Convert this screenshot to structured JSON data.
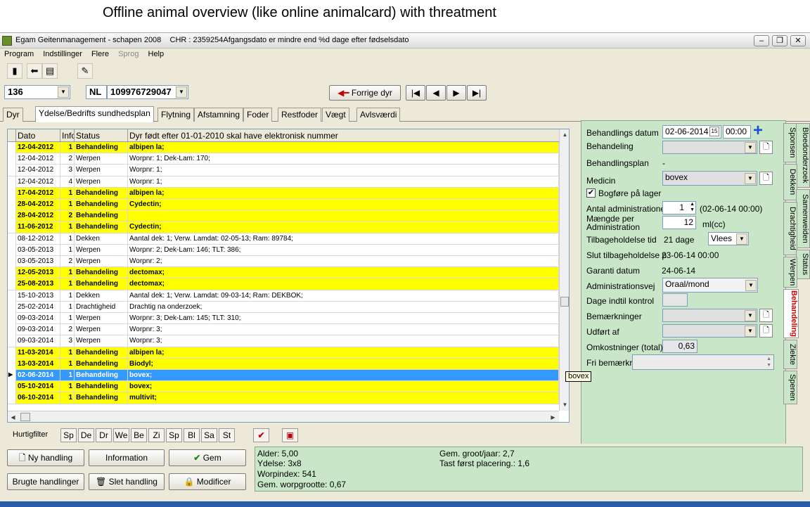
{
  "caption": "Offline animal overview (like online animalcard) with threatment",
  "window": {
    "title": "Egam Geitenmanagement - schapen 2008",
    "title_info": "CHR : 2359254Afgangsdato er mindre end %d dage efter fødselsdato"
  },
  "menu": [
    {
      "label": "Program"
    },
    {
      "label": "Indstillinger"
    },
    {
      "label": "Flere"
    },
    {
      "label": "Sprog"
    },
    {
      "label": "Help"
    }
  ],
  "selector": {
    "animal_no": "136",
    "country": "NL",
    "ear_no": "109976729047"
  },
  "nav": {
    "prev": "Forrige dyr"
  },
  "tabs": [
    "Dyr",
    "Ydelse/Bedrifts sundhedsplan",
    "Flytning",
    "Afstamning",
    "Foder",
    "Restfoder",
    "Vægt",
    "Avlsværdi"
  ],
  "grid": {
    "headers": [
      "Dato",
      "Info",
      "Status",
      "Dyr født efter 01-01-2010 skal have elektronisk nummer"
    ],
    "rows": [
      {
        "date": "12-04-2012",
        "info": "1",
        "status": "Behandeling",
        "text": "albipen la;",
        "type": "beh"
      },
      {
        "date": "12-04-2012",
        "info": "2",
        "status": "Werpen",
        "text": "Worpnr: 1; Dek-Lam: 170;",
        "type": ""
      },
      {
        "date": "12-04-2012",
        "info": "3",
        "status": "Werpen",
        "text": "Worpnr: 1;",
        "type": ""
      },
      {
        "date": "12-04-2012",
        "info": "4",
        "status": "Werpen",
        "text": "Worpnr: 1;",
        "type": ""
      },
      {
        "date": "17-04-2012",
        "info": "1",
        "status": "Behandeling",
        "text": "albipen la;",
        "type": "beh"
      },
      {
        "date": "28-04-2012",
        "info": "1",
        "status": "Behandeling",
        "text": "Cydectin;",
        "type": "beh"
      },
      {
        "date": "28-04-2012",
        "info": "2",
        "status": "Behandeling",
        "text": "",
        "type": "beh"
      },
      {
        "date": "11-06-2012",
        "info": "1",
        "status": "Behandeling",
        "text": "Cydectin;",
        "type": "beh"
      },
      {
        "date": "08-12-2012",
        "info": "1",
        "status": "Dekken",
        "text": "Aantal dek: 1; Verw. Lamdat: 02-05-13; Ram: 89784;",
        "type": ""
      },
      {
        "date": "03-05-2013",
        "info": "1",
        "status": "Werpen",
        "text": "Worpnr: 2; Dek-Lam: 146; TLT: 386;",
        "type": ""
      },
      {
        "date": "03-05-2013",
        "info": "2",
        "status": "Werpen",
        "text": "Worpnr: 2;",
        "type": ""
      },
      {
        "date": "12-05-2013",
        "info": "1",
        "status": "Behandeling",
        "text": "dectomax;",
        "type": "beh"
      },
      {
        "date": "25-08-2013",
        "info": "1",
        "status": "Behandeling",
        "text": "dectomax;",
        "type": "beh"
      },
      {
        "date": "15-10-2013",
        "info": "1",
        "status": "Dekken",
        "text": "Aantal dek: 1; Verw. Lamdat: 09-03-14; Ram: DEKBOK;",
        "type": ""
      },
      {
        "date": "25-02-2014",
        "info": "1",
        "status": "Drachtigheid",
        "text": "Drachtig na onderzoek;",
        "type": ""
      },
      {
        "date": "09-03-2014",
        "info": "1",
        "status": "Werpen",
        "text": "Worpnr: 3; Dek-Lam: 145; TLT: 310;",
        "type": ""
      },
      {
        "date": "09-03-2014",
        "info": "2",
        "status": "Werpen",
        "text": "Worpnr: 3;",
        "type": ""
      },
      {
        "date": "09-03-2014",
        "info": "3",
        "status": "Werpen",
        "text": "Worpnr: 3;",
        "type": ""
      },
      {
        "date": "11-03-2014",
        "info": "1",
        "status": "Behandeling",
        "text": "albipen la;",
        "type": "beh"
      },
      {
        "date": "13-03-2014",
        "info": "1",
        "status": "Behandeling",
        "text": "Biodyl;",
        "type": "beh"
      },
      {
        "date": "02-06-2014",
        "info": "1",
        "status": "Behandeling",
        "text": "bovex;",
        "type": "sel"
      },
      {
        "date": "05-10-2014",
        "info": "1",
        "status": "Behandeling",
        "text": "bovex;",
        "type": "beh"
      },
      {
        "date": "06-10-2014",
        "info": "1",
        "status": "Behandeling",
        "text": "multivit;",
        "type": "beh"
      }
    ]
  },
  "hurtigfilter": {
    "label": "Hurtigfilter",
    "buttons": [
      "Sp",
      "De",
      "Dr",
      "We",
      "Be",
      "Zi",
      "Sp",
      "Bl",
      "Sa",
      "St"
    ]
  },
  "form": {
    "behandlings_datum_label": "Behandlings datum",
    "behandlings_datum": "02-06-2014",
    "time": "00:00",
    "behandeling_label": "Behandeling",
    "behandlingsplan_label": "Behandlingsplan",
    "behandlingsplan": "-",
    "medicin_label": "Medicin",
    "medicin": "bovex",
    "bogfore_label": "Bogføre på lager",
    "antal_label": "Antal administratione",
    "antal": "1",
    "antal_info": "(02-06-14  00:00)",
    "maengde_label": "Mængde per Administration",
    "maengde": "12",
    "maengde_unit": "ml(cc)",
    "tilbage_label": "Tilbageholdelse tid",
    "tilbage": "21 dage",
    "tilbage_type": "Vlees",
    "slut_label": "Slut tilbageholdelse p",
    "slut": "23-06-14   00:00",
    "garanti_label": "Garanti datum",
    "garanti": "24-06-14",
    "admvej_label": "Administrationsvej",
    "admvej": "Oraal/mond",
    "dage_label": "Dage indtil kontrol",
    "bem_label": "Bemærkninger",
    "udfort_label": "Udført af",
    "omk_label": "Omkostninger (total)",
    "omk": "0,63",
    "fri_label": "Fri bemærkr"
  },
  "vtabs_col1": [
    "Bloedonderzoek",
    "Dekken",
    "Drachtigheid",
    "Werpen",
    "Behandeling",
    "Ziekte",
    "Spenen"
  ],
  "vtabs_col2": [
    "Sponsen",
    "Samenweiden",
    "Status"
  ],
  "tooltip": "bovex",
  "buttons": {
    "ny": "Ny handling",
    "info": "Information",
    "gem": "Gem",
    "brugte": "Brugte handlinger",
    "slet": "Slet handling",
    "modificer": "Modificer"
  },
  "info": {
    "alder": "Alder: 5,00",
    "ydelse": "Ydelse: 3x8",
    "worp": "Worpindex: 541",
    "gem_worp": "Gem. worpgrootte: 0,67",
    "gem_groot": "Gem. groot/jaar: 2,7",
    "tast": "Tast først placering.: 1,6"
  }
}
